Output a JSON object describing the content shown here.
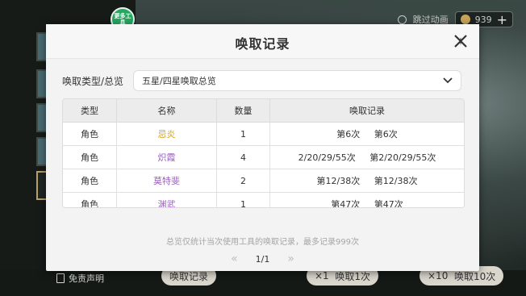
{
  "background": {
    "top_right": {
      "skip_anim_label": "跳过动画",
      "currency": "939",
      "plus": "+"
    },
    "tool_badge": "更多工具",
    "disclaimer": "免责声明",
    "bottom_buttons": [
      "唤取记录",
      "×1",
      "唤取1次",
      "×10",
      "唤取10次"
    ]
  },
  "modal": {
    "title": "唤取记录",
    "filter_label": "唤取类型/总览",
    "filter_value": "五星/四星唤取总览",
    "table": {
      "headers": [
        "类型",
        "名称",
        "数量",
        "唤取记录"
      ],
      "rows": [
        {
          "type": "角色",
          "name": "忌炎",
          "name_color": "#d4a21a",
          "count": "1",
          "records": [
            "第6次",
            "第6次"
          ]
        },
        {
          "type": "角色",
          "name": "炽霞",
          "name_color": "#9b5fc0",
          "count": "4",
          "records": [
            "2/20/29/55次",
            "第2/20/29/55次"
          ]
        },
        {
          "type": "角色",
          "name": "莫特斐",
          "name_color": "#9b5fc0",
          "count": "2",
          "records": [
            "第12/38次",
            "第12/38次"
          ]
        },
        {
          "type": "角色",
          "name": "渊武",
          "name_color": "#9b5fc0",
          "count": "1",
          "records": [
            "第47次",
            "第47次"
          ]
        }
      ]
    },
    "footer_note": "总览仅统计当次使用工具的唤取记录，最多记录999次",
    "pager": {
      "prev": "«",
      "page": "1/1",
      "next": "»"
    }
  }
}
